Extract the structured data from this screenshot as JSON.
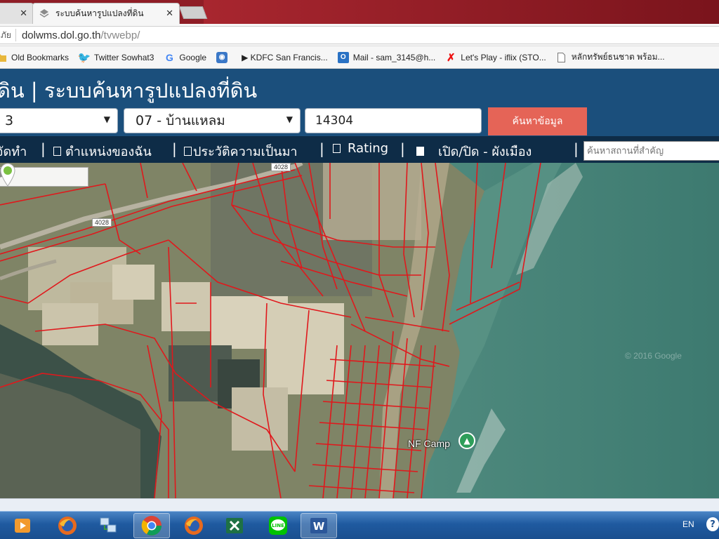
{
  "browser": {
    "tabs": [
      {
        "title": ""
      },
      {
        "title": "ระบบค้นหารูปแปลงที่ดิน"
      }
    ],
    "address": {
      "security_label": "ภัย",
      "host": "dolwms.dol.go.th",
      "path": "/tvwebp/"
    },
    "bookmarks": [
      {
        "label": "Old Bookmarks",
        "icon": "folder-icon"
      },
      {
        "label": "Twitter Sowhat3",
        "icon": "twitter-icon"
      },
      {
        "label": "Google",
        "icon": "google-icon"
      },
      {
        "label": "",
        "icon": "rss-icon"
      },
      {
        "label": "▶ KDFC San Francis...",
        "icon": "play-icon"
      },
      {
        "label": "Mail - sam_3145@h...",
        "icon": "outlook-icon"
      },
      {
        "label": "Let's Play - iflix (STO...",
        "icon": "iflix-icon"
      },
      {
        "label": "หลักทรัพย์ธนชาต พร้อม...",
        "icon": "page-icon"
      }
    ]
  },
  "site": {
    "title": "ดิน | ระบบค้นหารูปแปลงที่ดิน",
    "province_select": "3",
    "district_select": "07 - บ้านแหลม",
    "parcel_input": "14304",
    "search_button": "ค้นหาข้อมูล",
    "menu": {
      "item1": "จัดทำ",
      "item2": "ตำแหน่งของฉัน",
      "item3": "ประวัติความเป็นมา",
      "item4": "Rating",
      "item5": "เปิด/ปิด - ผังเมือง",
      "separator": "|"
    },
    "place_search_placeholder": "ค้นหาสถานที่สำคัญ"
  },
  "map": {
    "road_labels": [
      "4028",
      "4028"
    ],
    "place_label": "NF Camp",
    "copyright": "© 2016 Google",
    "parcel_line_color": "#e0181c",
    "marker_color": "#7bc142"
  },
  "taskbar": {
    "apps": [
      "media-player-icon",
      "firefox-icon",
      "network-icon",
      "chrome-icon",
      "firefox-icon",
      "excel-icon",
      "line-icon",
      "word-icon"
    ],
    "language": "EN",
    "help": "?"
  }
}
